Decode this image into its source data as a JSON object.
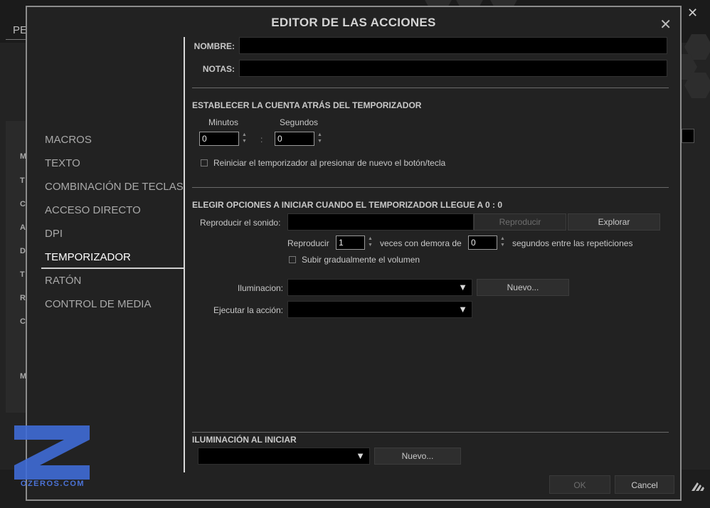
{
  "background": {
    "top_left_label": "PE",
    "left_letters": [
      "M",
      "T",
      "C",
      "A",
      "D",
      "T",
      "R",
      "C",
      "M"
    ],
    "close_icon": "close-icon",
    "brand_icon": "corsair-logo"
  },
  "dialog": {
    "title": "EDITOR DE LAS ACCIONES",
    "close_symbol": "✕"
  },
  "nav": {
    "items": [
      {
        "label": "MACROS",
        "active": false
      },
      {
        "label": "TEXTO",
        "active": false
      },
      {
        "label": "COMBINACIÓN DE TECLAS",
        "active": false
      },
      {
        "label": "ACCESO DIRECTO",
        "active": false
      },
      {
        "label": "DPI",
        "active": false
      },
      {
        "label": "TEMPORIZADOR",
        "active": true
      },
      {
        "label": "RATÓN",
        "active": false
      },
      {
        "label": "CONTROL DE MEDIA",
        "active": false
      }
    ]
  },
  "form": {
    "name_label": "NOMBRE:",
    "name_value": "",
    "notes_label": "NOTAS:",
    "notes_value": ""
  },
  "timer": {
    "section_title": "ESTABLECER LA CUENTA ATRÁS DEL TEMPORIZADOR",
    "minutes_label": "Minutos",
    "seconds_label": "Segundos",
    "minutes_value": "0",
    "seconds_value": "0",
    "colon": ":",
    "reset_label": "Reiniciar el temporizador al presionar de nuevo el botón/tecla",
    "reset_checked": false
  },
  "options": {
    "section_title": "ELEGIR OPCIONES A INICIAR CUANDO EL TEMPORIZADOR LLEGUE A 0 : 0",
    "sound_label": "Reproducir el sonido:",
    "sound_value": "",
    "play_button": "Reproducir",
    "browse_button": "Explorar",
    "repeat_prefix": "Reproducir",
    "repeat_value": "1",
    "repeat_middle": "veces con demora de",
    "delay_value": "0",
    "repeat_suffix": "segundos entre las repeticiones",
    "fade_label": "Subir gradualmente el volumen",
    "fade_checked": false,
    "lighting_label": "Iluminacion:",
    "lighting_value": "",
    "lighting_new_button": "Nuevo...",
    "action_label": "Ejecutar la acción:",
    "action_value": ""
  },
  "start_lighting": {
    "section_title": "ILUMINACIÓN AL INICIAR",
    "value": "",
    "new_button": "Nuevo..."
  },
  "footer": {
    "ok": "OK",
    "cancel": "Cancel"
  },
  "watermark": {
    "text": "OZEROS.COM"
  },
  "colors": {
    "dialog_bg": "#222222",
    "field_bg": "#000000",
    "accent_watermark": "#3f6bd6"
  }
}
